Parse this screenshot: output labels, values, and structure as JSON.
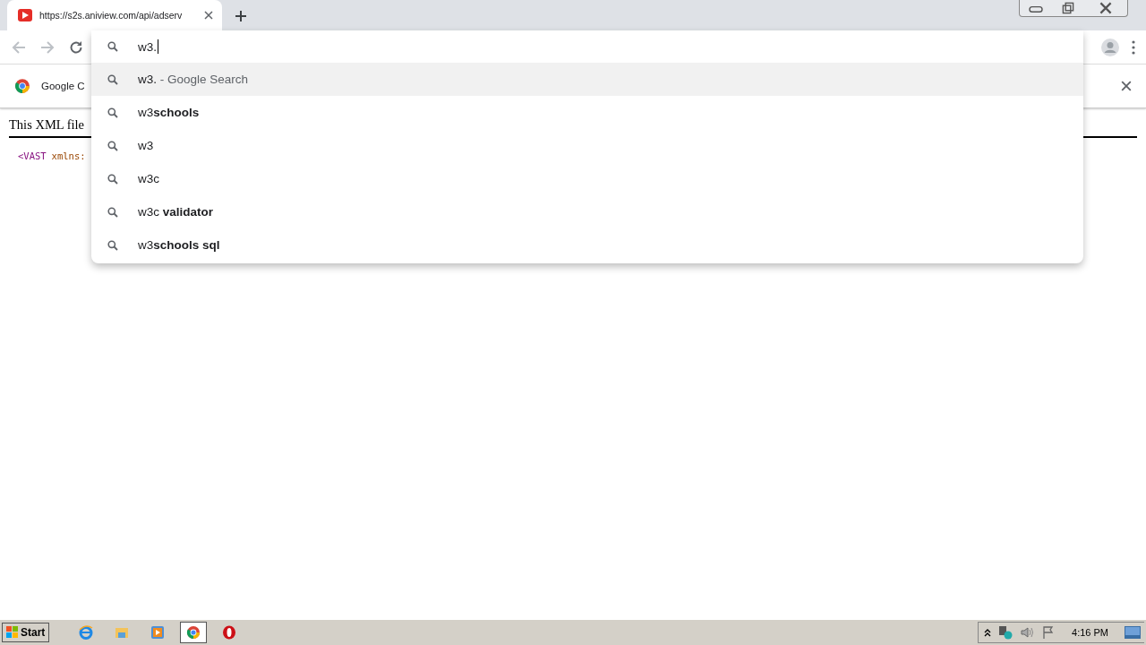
{
  "tab": {
    "title": "https://s2s.aniview.com/api/adserv",
    "selected": true
  },
  "toolbar": {
    "back_disabled": true,
    "forward_disabled": true
  },
  "omnibox": {
    "value": "w3."
  },
  "suggestions": [
    {
      "text": "w3.",
      "suffix": " - Google Search",
      "selected": true
    },
    {
      "text": "w3**schools**",
      "selected": false
    },
    {
      "text": "w3",
      "selected": false
    },
    {
      "text": "w3c",
      "selected": false
    },
    {
      "text": "w3c **validator**",
      "selected": false
    },
    {
      "text": "w3**schools sql**",
      "selected": false
    }
  ],
  "infobar": {
    "text": "Google C"
  },
  "page": {
    "heading": "This XML file",
    "code": [
      {
        "text": "<VAST",
        "kind": "tag"
      },
      {
        "text": "xmlns:",
        "kind": "attr"
      }
    ]
  },
  "taskbar": {
    "start": "Start",
    "apps": [
      {
        "kind": "ie",
        "selected": false
      },
      {
        "kind": "folder",
        "selected": false
      },
      {
        "kind": "media",
        "selected": false
      },
      {
        "kind": "chrome",
        "selected": true
      },
      {
        "kind": "opera",
        "selected": false
      }
    ],
    "clock": "4:16 PM"
  }
}
